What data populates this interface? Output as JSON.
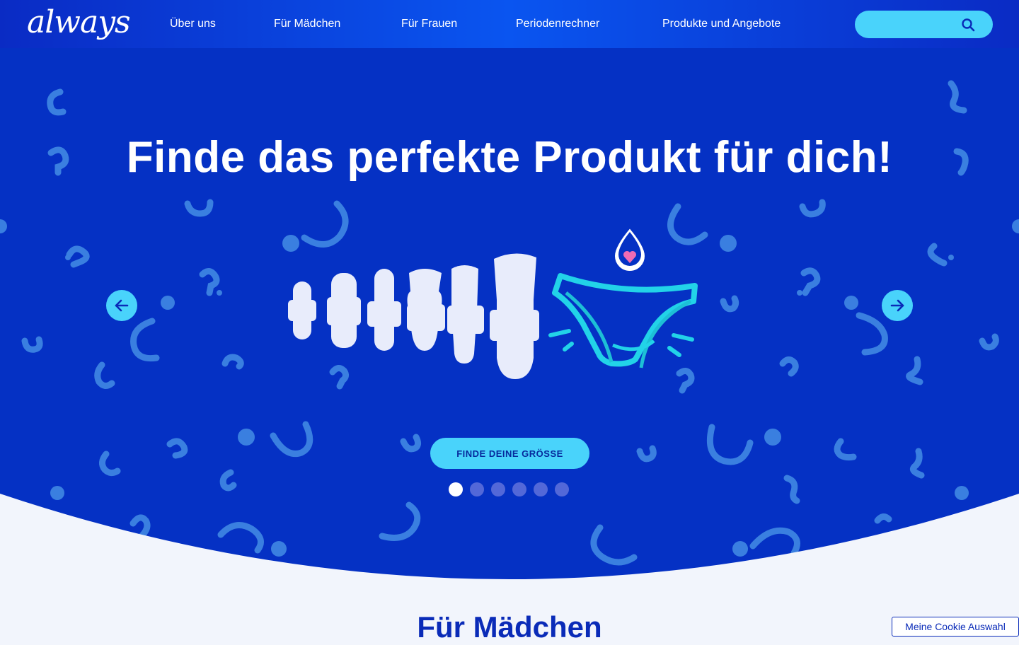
{
  "header": {
    "logo_text": "always",
    "nav": [
      {
        "label": "Über uns"
      },
      {
        "label": "Für Mädchen"
      },
      {
        "label": "Für Frauen"
      },
      {
        "label": "Periodenrechner"
      },
      {
        "label": "Produkte und Angebote"
      }
    ],
    "search": {
      "placeholder": "",
      "icon": "search-icon"
    }
  },
  "hero": {
    "title": "Finde das perfekte Produkt für dich!",
    "cta_label": "FINDE DEINE GRÖSSE",
    "prev_icon": "arrow-left-icon",
    "next_icon": "arrow-right-icon",
    "slides_total": 6,
    "active_slide": 1
  },
  "section": {
    "title": "Für Mädchen"
  },
  "cookie": {
    "label": "Meine Cookie Auswahl"
  },
  "colors": {
    "header_blue": "#0a2bc4",
    "hero_blue": "#0531c4",
    "accent_cyan": "#49d3fb",
    "question_marks": "#3a7fe0",
    "page_bg": "#f2f5fc",
    "section_title": "#0a2bb8"
  }
}
